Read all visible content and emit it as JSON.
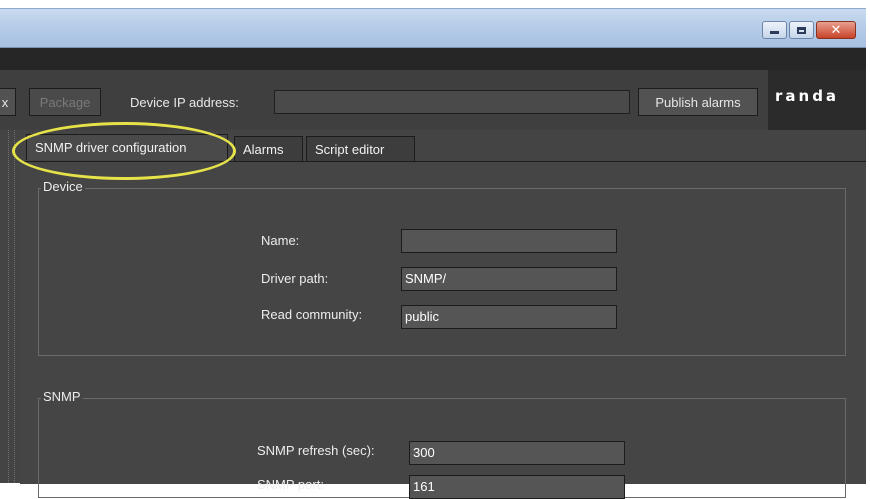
{
  "window": {
    "controls": {
      "minimize_icon": "minimize-icon",
      "maximize_icon": "maximize-icon",
      "close_icon": "close-icon"
    }
  },
  "toolbar": {
    "partial_left_label": "x",
    "package_label": "Package",
    "device_ip_label": "Device IP address:",
    "device_ip_value": "",
    "publish_alarms_label": "Publish alarms",
    "logo_text": "randa"
  },
  "tabs": [
    {
      "label": "SNMP driver configuration",
      "active": true
    },
    {
      "label": "Alarms",
      "active": false
    },
    {
      "label": "Script editor",
      "active": false
    }
  ],
  "device_section": {
    "legend": "Device",
    "fields": [
      {
        "label": "Name:",
        "value": ""
      },
      {
        "label": "Driver path:",
        "value": "SNMP/"
      },
      {
        "label": "Read community:",
        "value": "public"
      }
    ]
  },
  "snmp_section": {
    "legend": "SNMP",
    "fields": [
      {
        "label": "SNMP refresh (sec):",
        "value": "300"
      },
      {
        "label": "SNMP port:",
        "value": "161"
      }
    ]
  },
  "colors": {
    "app_background": "#444444",
    "annotation_highlight": "#e6e24a",
    "titlebar": "#b6cce8"
  }
}
